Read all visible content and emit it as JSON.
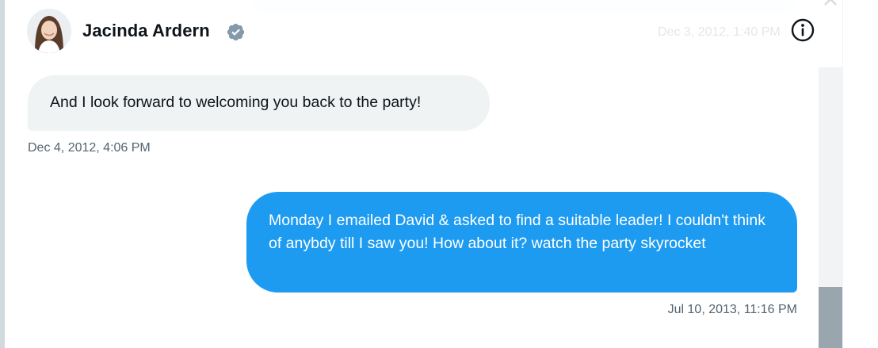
{
  "conversation": {
    "contact_name": "Jacinda Ardern",
    "verified_icon": "verified-badge-icon",
    "info_icon": "info-icon",
    "scroll_up_icon": "chevron-up-icon",
    "faded_timestamp": "Dec 3, 2012, 1:40 PM"
  },
  "messages": [
    {
      "direction": "incoming",
      "text": "And I look forward to welcoming you back to the party!",
      "timestamp": "Dec 4, 2012, 4:06 PM"
    },
    {
      "direction": "outgoing",
      "text": "Monday I emailed David & asked to find a suitable leader! I couldn't think of anybdy till I saw you! How about it? watch the party skyrocket",
      "timestamp": "Jul 10, 2013, 11:16 PM"
    }
  ],
  "colors": {
    "outgoing_bubble": "#1d9bf0",
    "incoming_bubble": "#eff3f4",
    "verified_badge": "#829aab",
    "timestamp": "#536471",
    "text_primary": "#0f1419"
  }
}
